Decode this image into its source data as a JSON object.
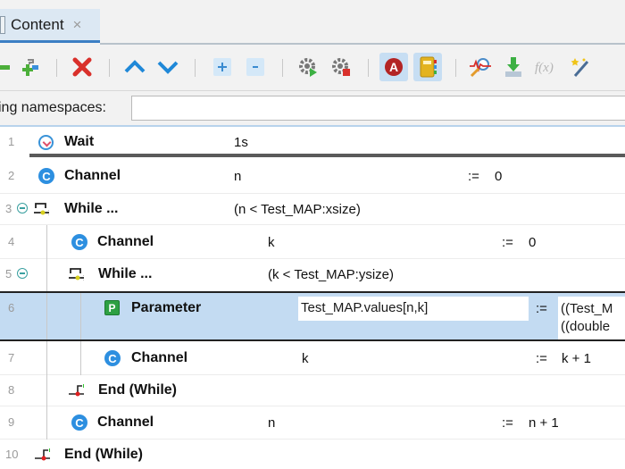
{
  "tab": {
    "label": "Content",
    "close": "×"
  },
  "toolbar": {
    "buttons": [
      {
        "name": "add-step",
        "icon": "green-plus-icon"
      },
      {
        "name": "insert-step",
        "icon": "add-parameter-icon"
      },
      {
        "name": "delete",
        "icon": "delete-x-icon"
      },
      {
        "name": "move-up",
        "icon": "chevron-up-icon"
      },
      {
        "name": "move-down",
        "icon": "chevron-down-icon"
      },
      {
        "name": "expand-all",
        "icon": "expand-plus-icon"
      },
      {
        "name": "collapse-all",
        "icon": "collapse-minus-icon"
      },
      {
        "name": "run",
        "icon": "gear-run-icon"
      },
      {
        "name": "stop",
        "icon": "gear-stop-icon"
      },
      {
        "name": "toggle-a",
        "icon": "red-a-icon"
      },
      {
        "name": "notebook",
        "icon": "notebook-icon"
      },
      {
        "name": "analyze",
        "icon": "signal-magnifier-icon"
      },
      {
        "name": "import",
        "icon": "download-arrow-icon"
      },
      {
        "name": "function",
        "icon": "function-fx-icon",
        "label": "f(x)"
      },
      {
        "name": "magic",
        "icon": "magic-wand-icon"
      }
    ]
  },
  "namespaces": {
    "label": "ing namespaces:",
    "value": ""
  },
  "steps": [
    {
      "line": "1",
      "type": "Wait",
      "name": "Wait",
      "target": "1s",
      "op": "",
      "value": ""
    },
    {
      "line": "2",
      "type": "Channel",
      "name": "Channel",
      "target": "n",
      "op": ":=",
      "value": "0"
    },
    {
      "line": "3",
      "type": "While",
      "name": "While ...",
      "target": "(n < Test_MAP:xsize)",
      "op": "",
      "value": ""
    },
    {
      "line": "4",
      "type": "Channel",
      "name": "Channel",
      "target": "k",
      "op": ":=",
      "value": "0"
    },
    {
      "line": "5",
      "type": "While",
      "name": "While ...",
      "target": "(k < Test_MAP:ysize)",
      "op": "",
      "value": ""
    },
    {
      "line": "6",
      "type": "Parameter",
      "name": "Parameter",
      "target": "Test_MAP.values[n,k]",
      "op": ":=",
      "value": "((Test_M",
      "value2": "((double"
    },
    {
      "line": "7",
      "type": "Channel",
      "name": "Channel",
      "target": "k",
      "op": ":=",
      "value": "k + 1"
    },
    {
      "line": "8",
      "type": "EndWhile",
      "name": "End (While)",
      "target": "",
      "op": "",
      "value": ""
    },
    {
      "line": "9",
      "type": "Channel",
      "name": "Channel",
      "target": "n",
      "op": ":=",
      "value": "n + 1"
    },
    {
      "line": "10",
      "type": "EndWhile",
      "name": "End (While)",
      "target": "",
      "op": "",
      "value": ""
    }
  ]
}
